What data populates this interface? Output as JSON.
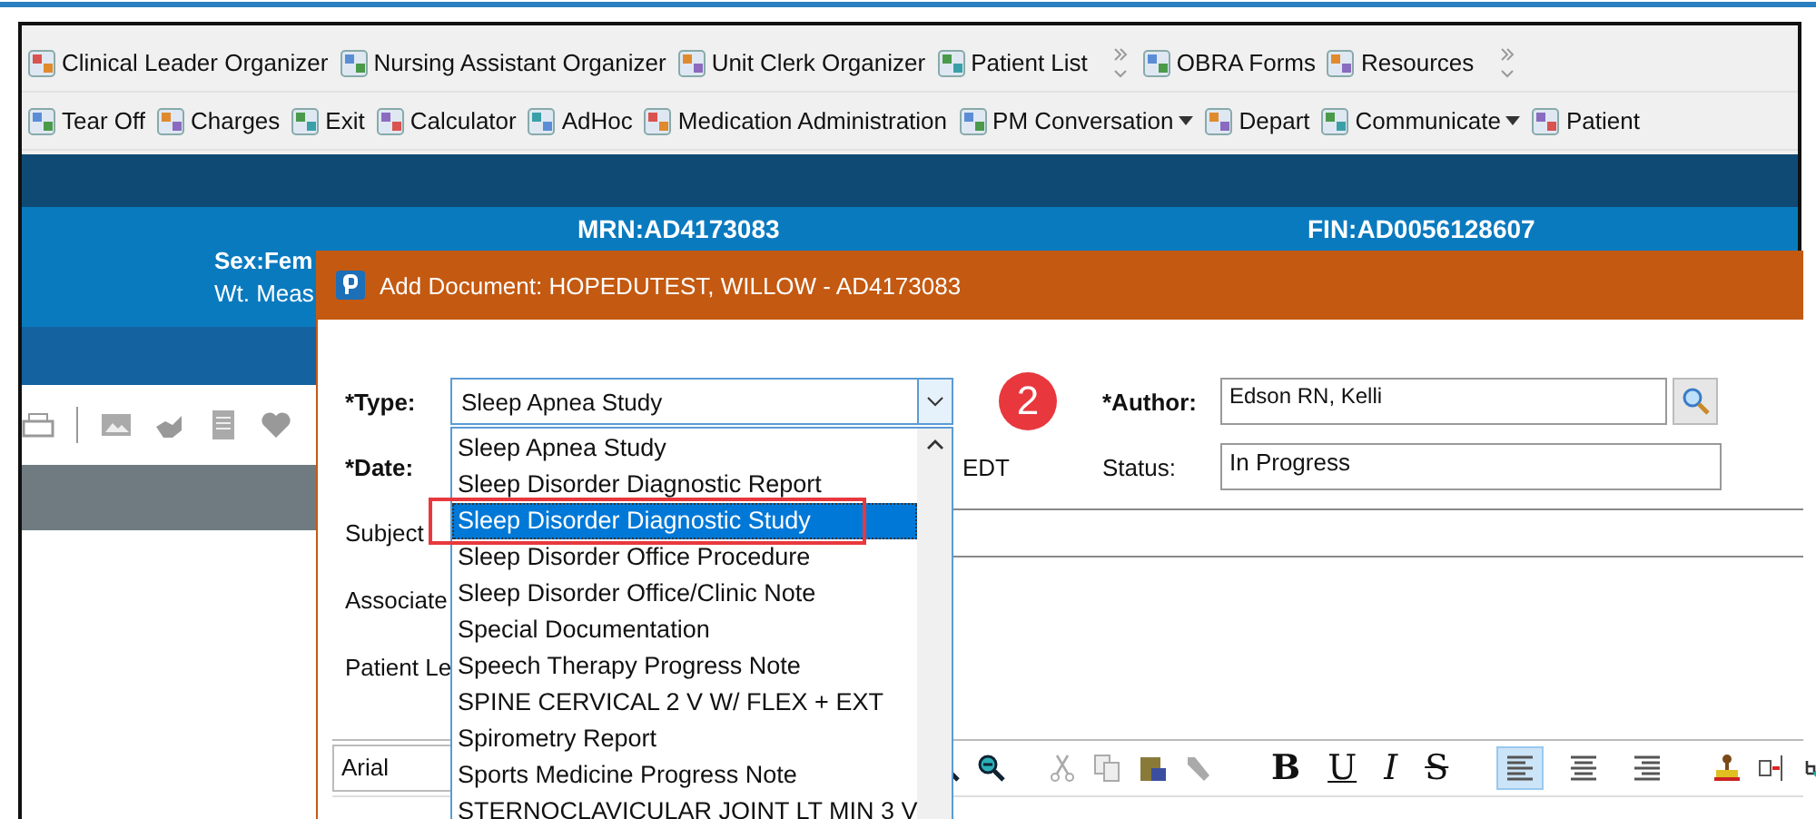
{
  "toolbar_rows": [
    [
      {
        "items": [
          {
            "label": "Clinical Leader Organizer",
            "dropdown": false
          },
          {
            "label": "Nursing Assistant Organizer",
            "dropdown": false
          },
          {
            "label": "Unit Clerk Organizer",
            "dropdown": false
          },
          {
            "label": "Patient List",
            "dropdown": false
          }
        ],
        "overflow": true
      },
      {
        "items": [
          {
            "label": "OBRA Forms",
            "dropdown": false
          },
          {
            "label": "Resources",
            "dropdown": false
          }
        ],
        "overflow": true
      }
    ],
    [
      {
        "items": [
          {
            "label": "Tear Off",
            "dropdown": false
          },
          {
            "label": "Charges",
            "dropdown": false
          },
          {
            "label": "Exit",
            "dropdown": false
          },
          {
            "label": "Calculator",
            "dropdown": false
          },
          {
            "label": "AdHoc",
            "dropdown": false
          },
          {
            "label": "Medication Administration",
            "dropdown": false
          },
          {
            "label": "PM Conversation",
            "dropdown": true
          },
          {
            "label": "Depart",
            "dropdown": false
          },
          {
            "label": "Communicate",
            "dropdown": true
          },
          {
            "label": "Patient",
            "dropdown": false
          }
        ],
        "overflow": false
      }
    ]
  ],
  "banner": {
    "sex": "Sex:Fem",
    "weight": "Wt. Meas",
    "mrn": "MRN:AD4173083",
    "fin": "FIN:AD0056128607"
  },
  "dialog": {
    "title": "Add Document: HOPEDUTEST, WILLOW - AD4173083",
    "type_label": "*Type:",
    "type_value": "Sleep Apnea Study",
    "badge": "2",
    "author_label": "*Author:",
    "author_value": "Edson RN, Kelli",
    "date_label": "*Date:",
    "timezone": "EDT",
    "status_label": "Status:",
    "status_value": "In Progress",
    "subject_label": "Subject",
    "associate_label": "Associate",
    "patient_label": "Patient Le",
    "font": "Arial",
    "format_buttons": [
      "B",
      "U",
      "I",
      "S"
    ],
    "align_buttons": [
      {
        "selected": true
      },
      {
        "selected": false
      },
      {
        "selected": false
      }
    ],
    "type_options": [
      {
        "label": "Sleep Apnea Study",
        "selected": false,
        "highlighted": false
      },
      {
        "label": "Sleep Disorder Diagnostic Report",
        "selected": false,
        "highlighted": false
      },
      {
        "label": "Sleep Disorder Diagnostic Study",
        "selected": true,
        "highlighted": true
      },
      {
        "label": "Sleep Disorder Office Procedure",
        "selected": false,
        "highlighted": false
      },
      {
        "label": "Sleep Disorder Office/Clinic Note",
        "selected": false,
        "highlighted": false
      },
      {
        "label": "Special Documentation",
        "selected": false,
        "highlighted": false
      },
      {
        "label": "Speech Therapy Progress Note",
        "selected": false,
        "highlighted": false
      },
      {
        "label": "SPINE CERVICAL 2 V W/ FLEX + EXT",
        "selected": false,
        "highlighted": false
      },
      {
        "label": "Spirometry Report",
        "selected": false,
        "highlighted": false
      },
      {
        "label": "Sports Medicine Progress Note",
        "selected": false,
        "highlighted": false
      },
      {
        "label": "STERNOCLAVICULAR JOINT LT MIN 3 V",
        "selected": false,
        "highlighted": false
      }
    ]
  }
}
